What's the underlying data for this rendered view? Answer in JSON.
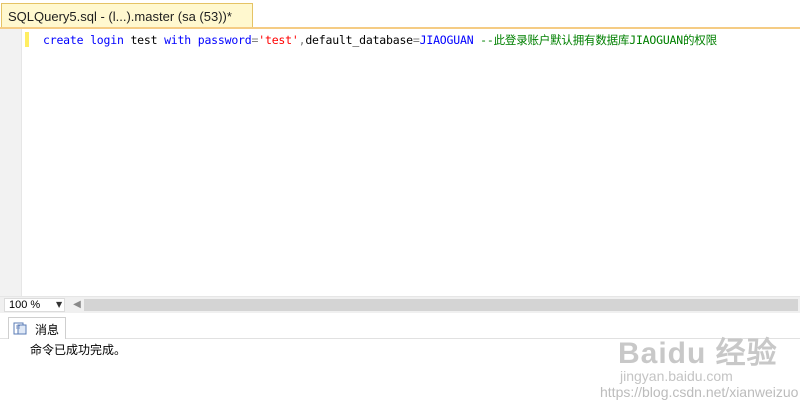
{
  "document_tab": {
    "title": "SQLQuery5.sql - (l...).master (sa (53))*"
  },
  "editor": {
    "line": {
      "kw_create": "create",
      "kw_login": "login",
      "plain_name": "test",
      "kw_with": "with",
      "kw_password": "password",
      "op_eq1": "=",
      "str_pwd": "'test'",
      "comma": ",",
      "plain_default_db": "default_database",
      "op_eq2": "=",
      "kw_db": "JIAOGUAN",
      "comment": "--此登录账户默认拥有数据库JIAOGUAN的权限"
    }
  },
  "zoom": {
    "value": "100 %"
  },
  "results": {
    "tab_label": "消息",
    "message": "命令已成功完成。"
  },
  "watermark": {
    "logo": "Baidu 经验",
    "url1": "jingyan.baidu.com",
    "url2": "https://blog.csdn.net/xianweizuo"
  },
  "colors": {
    "keyword": "#0000ff",
    "string": "#ff0000",
    "comment": "#008000",
    "tab_active": "#fff8cf"
  }
}
